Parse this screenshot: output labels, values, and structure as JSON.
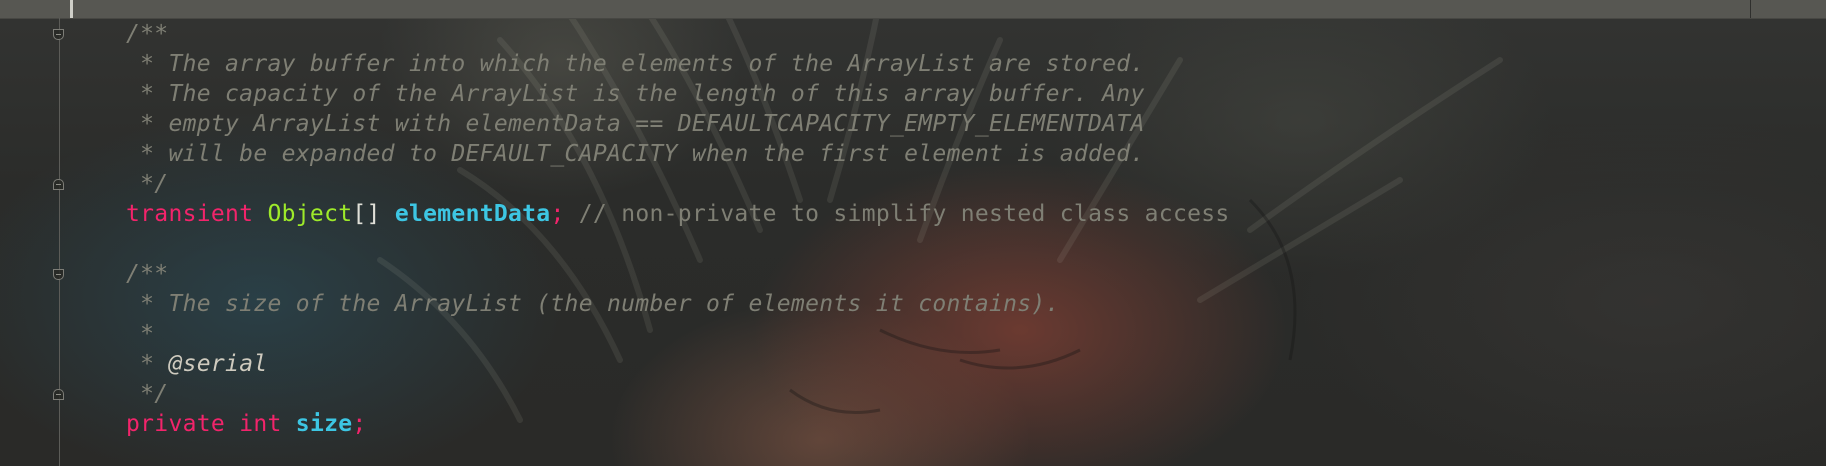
{
  "editor": {
    "lines": [
      {
        "comment": "/**"
      },
      {
        "comment": " * The array buffer into which the elements of the ArrayList are stored."
      },
      {
        "comment": " * The capacity of the ArrayList is the length of this array buffer. Any"
      },
      {
        "comment": " * empty ArrayList with elementData == DEFAULTCAPACITY_EMPTY_ELEMENTDATA"
      },
      {
        "comment": " * will be expanded to DEFAULT_CAPACITY when the first element is added."
      },
      {
        "comment": " */"
      },
      {
        "keyword": "transient",
        "type": "Object",
        "brackets": "[]",
        "field": "elementData",
        "semicolon": ";",
        "line_comment": "// non-private to simplify nested class access"
      },
      {},
      {
        "comment": "/**"
      },
      {
        "comment": " * The size of the ArrayList (the number of elements it contains)."
      },
      {
        "comment": " *"
      },
      {
        "comment": " * ",
        "tag": "@serial"
      },
      {
        "comment": " */"
      },
      {
        "keyword": "private",
        "type": "int",
        "field": "size",
        "semicolon": ";"
      }
    ]
  },
  "colors": {
    "keyword": "#f2246b",
    "type": "#9eea2a",
    "field": "#3dc6e3",
    "comment": "#7f7f74",
    "tab_bar": "#575752"
  },
  "icons": [
    "fold-open-icon",
    "fold-close-icon"
  ]
}
